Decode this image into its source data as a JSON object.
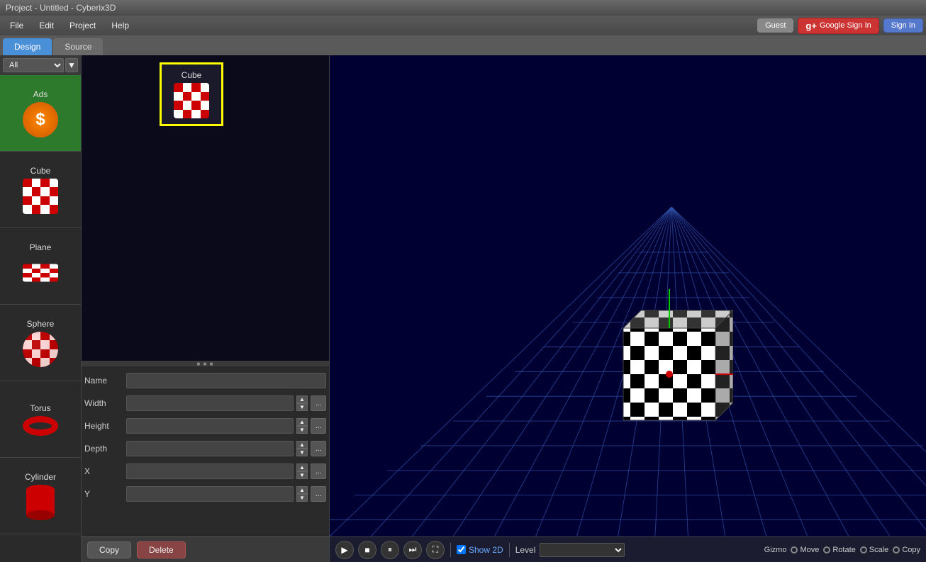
{
  "titleBar": {
    "title": "Project - Untitled - Cyberix3D"
  },
  "menuBar": {
    "items": [
      "File",
      "Edit",
      "Project",
      "Help"
    ],
    "auth": {
      "guest": "Guest",
      "google": "Google Sign In",
      "signin": "Sign In"
    }
  },
  "tabs": [
    {
      "id": "design",
      "label": "Design",
      "active": true
    },
    {
      "id": "source",
      "label": "Source",
      "active": false
    }
  ],
  "sidebar": {
    "filter": "All",
    "items": [
      {
        "id": "ads",
        "label": "Ads",
        "type": "ads"
      },
      {
        "id": "cube",
        "label": "Cube",
        "type": "cube"
      },
      {
        "id": "plane",
        "label": "Plane",
        "type": "plane"
      },
      {
        "id": "sphere",
        "label": "Sphere",
        "type": "sphere"
      },
      {
        "id": "torus",
        "label": "Torus",
        "type": "torus"
      },
      {
        "id": "cylinder",
        "label": "Cylinder",
        "type": "cylinder"
      }
    ]
  },
  "scene": {
    "selectedObject": {
      "label": "Cube"
    }
  },
  "properties": {
    "name": {
      "label": "Name",
      "value": ""
    },
    "width": {
      "label": "Width",
      "value": ""
    },
    "height": {
      "label": "Height",
      "value": ""
    },
    "depth": {
      "label": "Depth",
      "value": ""
    },
    "x": {
      "label": "X",
      "value": ""
    },
    "y": {
      "label": "Y",
      "value": ""
    }
  },
  "actionBar": {
    "copy": "Copy",
    "delete": "Delete"
  },
  "viewport": {
    "toolbar": {
      "show2d": "Show 2D",
      "level": "Level",
      "gizmo": "Gizmo",
      "move": "Move",
      "rotate": "Rotate",
      "scale": "Scale",
      "copy": "Copy"
    }
  }
}
